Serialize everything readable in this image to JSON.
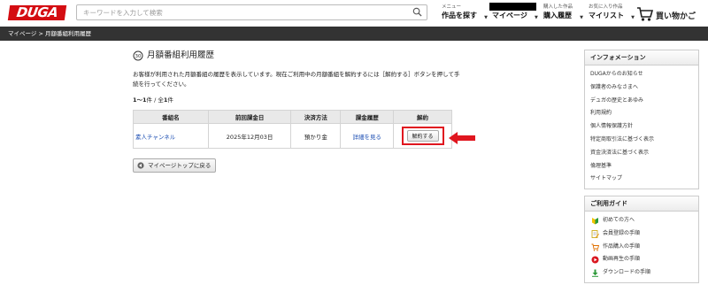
{
  "header": {
    "logo": "DUGA",
    "search_placeholder": "キーワードを入力して検索",
    "nav": [
      {
        "sub": "メニュー",
        "label": "作品を探す"
      },
      {
        "sub": "",
        "label": "マイページ"
      },
      {
        "sub": "購入した作品",
        "label": "購入履歴"
      },
      {
        "sub": "お気に入り作品",
        "label": "マイリスト"
      }
    ],
    "cart_label": "買い物かご",
    "caret": "▼"
  },
  "breadcrumb": {
    "home": "マイページ",
    "sep": ">",
    "current": "月額番組利用履歴"
  },
  "page": {
    "title": "月額番組利用履歴",
    "description": "お客様が利用された月額番組の履歴を表示しています。現在ご利用中の月額番組を解約するには［解約する］ボタンを押して手続を行ってください。",
    "count_prefix": "1～1",
    "count_unit1": "件 / 全",
    "count_total": "1",
    "count_unit2": "件",
    "table": {
      "headers": [
        "番組名",
        "前回課金日",
        "決済方法",
        "課金履歴",
        "解約"
      ],
      "rows": [
        {
          "name": "素人チャンネル",
          "last_charge": "2025年12月03日",
          "payment": "預かり金",
          "history": "詳細を見る",
          "cancel": "解約する"
        }
      ]
    },
    "back_label": "マイページトップに戻る"
  },
  "sidebar": {
    "info_title": "インフォメーション",
    "info_items": [
      "DUGAからのお知らせ",
      "保護者のみなさまへ",
      "デュガの歴史とあゆみ",
      "利用規約",
      "個人情報保護方針",
      "特定商取引法に基づく表示",
      "資金決済法に基づく表示",
      "倫理基準",
      "サイトマップ"
    ],
    "guide_title": "ご利用ガイド",
    "guide_items": [
      {
        "label": "初めての方へ",
        "icon": "beginner-icon"
      },
      {
        "label": "会員登録の手順",
        "icon": "registration-icon"
      },
      {
        "label": "作品購入の手順",
        "icon": "purchase-icon"
      },
      {
        "label": "動画再生の手順",
        "icon": "play-icon"
      },
      {
        "label": "ダウンロードの手順",
        "icon": "download-icon"
      }
    ]
  },
  "colors": {
    "brand": "#d40d12",
    "highlight": "#e0161f",
    "link": "#1d4fb3",
    "bar": "#333333"
  }
}
